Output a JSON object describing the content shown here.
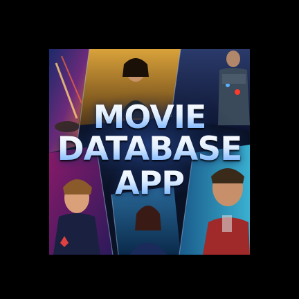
{
  "poster": {
    "title_lines": [
      "MOVIE",
      "DATABASE",
      "APP"
    ]
  },
  "colors": {
    "background": "#000000",
    "title_top": "#ffffff",
    "title_bottom": "#6fa8f0",
    "panel_dark": "#0a1226"
  }
}
